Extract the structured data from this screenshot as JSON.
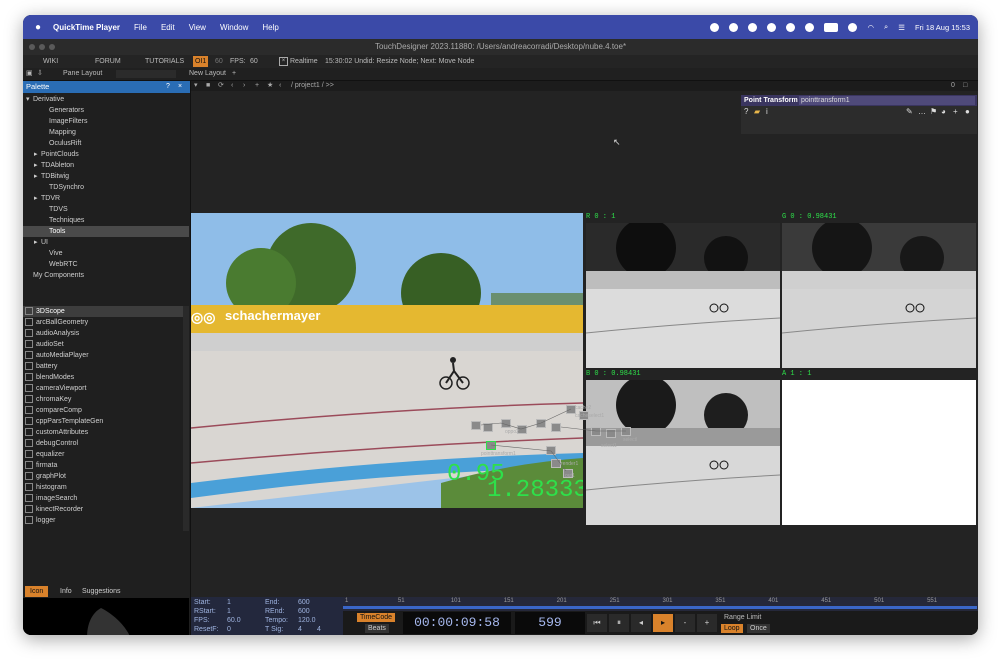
{
  "menubar": {
    "app_name": "QuickTime Player",
    "items": [
      "File",
      "Edit",
      "View",
      "Window",
      "Help"
    ],
    "date_time": "Fri 18 Aug  15:53"
  },
  "window": {
    "title": "TouchDesigner 2023.11880: /Users/andreacorradi/Desktop/nube.4.toe*"
  },
  "toolbar": {
    "wiki": "WIKI",
    "forum": "FORUM",
    "tutorials": "TUTORIALS",
    "oi": "OI1",
    "fps_label": "60",
    "fps": "FPS:",
    "fps_value": "60",
    "realtime": "Realtime",
    "status": "15:30:02 Undid: Resize Node; Next: Move Node"
  },
  "toolbar2": {
    "pane_layout": "Pane Layout",
    "new_layout": "New Layout",
    "path": "/ project1 / >>"
  },
  "palette": {
    "title": "Palette",
    "help": "?",
    "close": "×",
    "tree": [
      {
        "label": "Derivative",
        "indent": 0,
        "arrow": "▾"
      },
      {
        "label": "Generators",
        "indent": 2,
        "arrow": ""
      },
      {
        "label": "ImageFilters",
        "indent": 2,
        "arrow": ""
      },
      {
        "label": "Mapping",
        "indent": 2,
        "arrow": ""
      },
      {
        "label": "OculusRift",
        "indent": 2,
        "arrow": ""
      },
      {
        "label": "PointClouds",
        "indent": 1,
        "arrow": "▸"
      },
      {
        "label": "TDAbleton",
        "indent": 1,
        "arrow": "▸"
      },
      {
        "label": "TDBitwig",
        "indent": 1,
        "arrow": "▸"
      },
      {
        "label": "TDSynchro",
        "indent": 2,
        "arrow": ""
      },
      {
        "label": "TDVR",
        "indent": 1,
        "arrow": "▸"
      },
      {
        "label": "TDVS",
        "indent": 2,
        "arrow": ""
      },
      {
        "label": "Techniques",
        "indent": 2,
        "arrow": ""
      },
      {
        "label": "Tools",
        "indent": 2,
        "arrow": "",
        "selected": true
      },
      {
        "label": "UI",
        "indent": 1,
        "arrow": "▸"
      },
      {
        "label": "Vive",
        "indent": 2,
        "arrow": ""
      },
      {
        "label": "WebRTC",
        "indent": 2,
        "arrow": ""
      },
      {
        "label": "My Components",
        "indent": 0,
        "arrow": ""
      }
    ],
    "components": [
      "3DScope",
      "arcBallGeometry",
      "audioAnalysis",
      "audioSet",
      "autoMediaPlayer",
      "battery",
      "blendModes",
      "cameraViewport",
      "chromaKey",
      "compareComp",
      "cppParsTemplateGen",
      "customAttributes",
      "debugControl",
      "equalizer",
      "firmata",
      "graphPlot",
      "histogram",
      "imageSearch",
      "kinectRecorder",
      "logger"
    ],
    "tabs": {
      "icon": "Icon",
      "info": "Info",
      "suggestions": "Suggestions"
    }
  },
  "parameter_panel": {
    "type": "Point Transform",
    "name": "pointtransform1"
  },
  "viewers": {
    "overlay_top": "0.95",
    "overlay_bottom": "1.28333",
    "banner": "schachermayer",
    "channels": [
      {
        "label": "R 0 : 1"
      },
      {
        "label": "G 0 : 0.98431"
      },
      {
        "label": "B 0 : 0.98431"
      },
      {
        "label": "A 1 : 1"
      }
    ]
  },
  "nodes": {
    "labels": [
      "cache2",
      "cacheselect1",
      "oppo2",
      "selectl",
      "select1",
      "pointtransform1",
      "render1",
      "out1"
    ]
  },
  "timeline": {
    "start_label": "Start:",
    "start": "1",
    "rstart_label": "RStart:",
    "rstart": "1",
    "fps_label": "FPS:",
    "fps": "60.0",
    "resetf_label": "ResetF:",
    "resetf": "0",
    "end_label": "End:",
    "end": "600",
    "rend_label": "REnd:",
    "rend": "600",
    "tempo_label": "Tempo:",
    "tempo": "120.0",
    "tsig_label": "T Sig:",
    "tsig_a": "4",
    "tsig_b": "4",
    "ticks": [
      "1",
      "51",
      "101",
      "151",
      "201",
      "251",
      "301",
      "351",
      "401",
      "451",
      "501",
      "551"
    ],
    "progress": 0.998,
    "timecode_label": "TimeCode",
    "beats_label": "Beats",
    "timecode": "00:00:09:58",
    "frame": "599",
    "range_limit": "Range Limit",
    "loop": "Loop",
    "once": "Once"
  },
  "colors": {
    "accent": "#d9822b",
    "menubar": "#3b4aa8",
    "overlay_text": "#2ee04a"
  }
}
